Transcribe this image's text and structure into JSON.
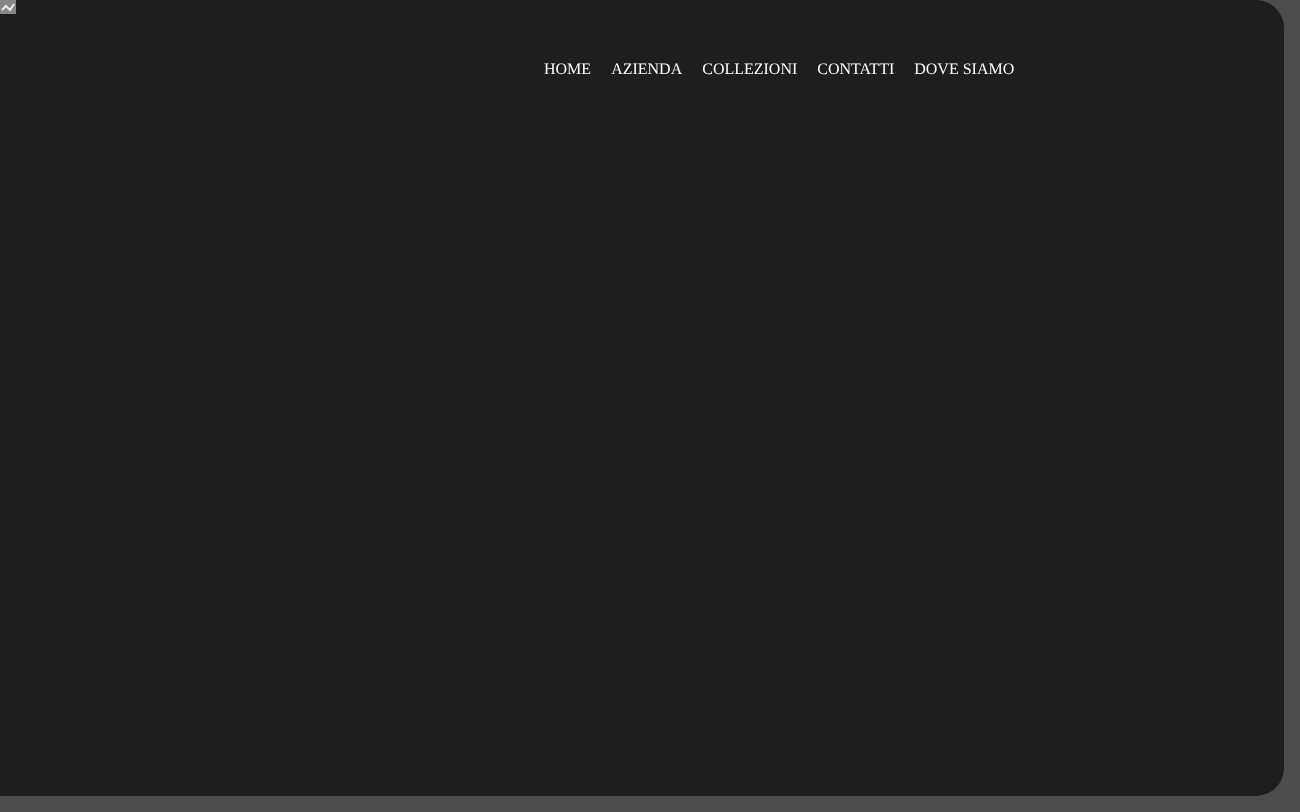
{
  "nav": {
    "items": [
      {
        "label": "HOME"
      },
      {
        "label": "AZIENDA"
      },
      {
        "label": "COLLEZIONI"
      },
      {
        "label": "CONTATTI"
      },
      {
        "label": "DOVE SIAMO"
      }
    ]
  }
}
